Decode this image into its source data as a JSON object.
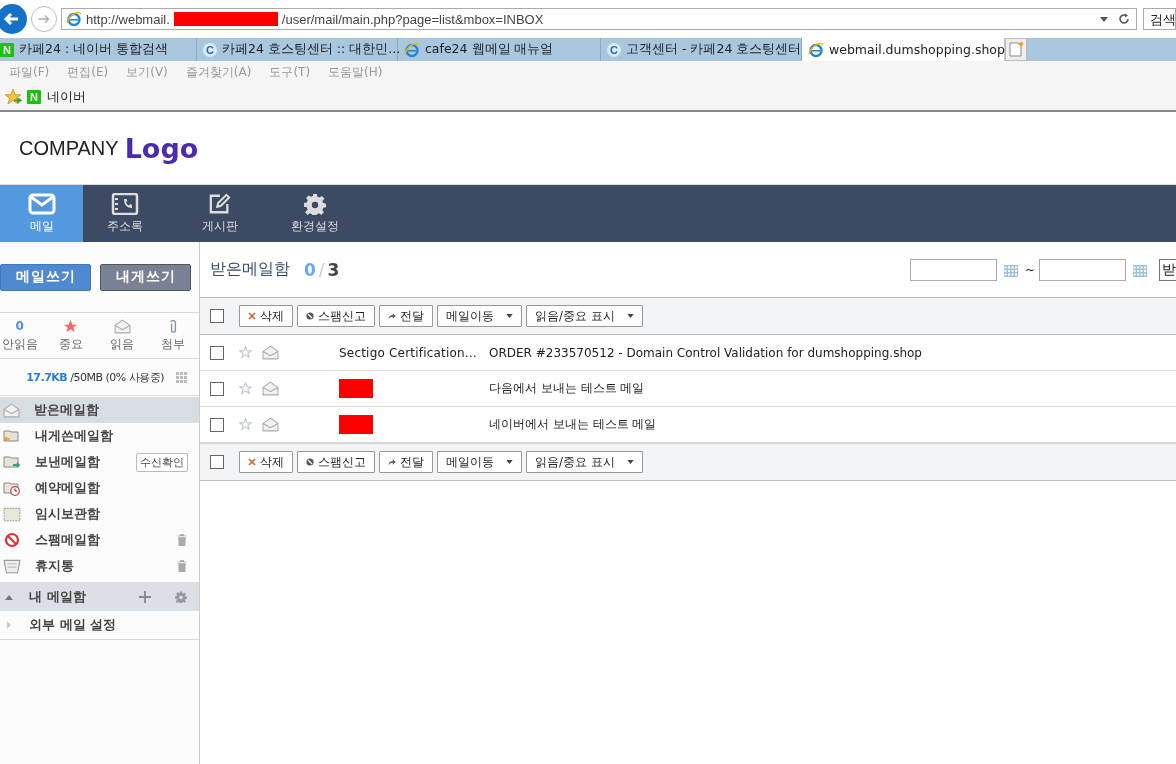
{
  "browser": {
    "url": {
      "prefix": "http://webmail.",
      "redacted": true,
      "suffix": "/user/mail/main.php?page=list&mbox=INBOX"
    },
    "search": "검색",
    "tabs": [
      {
        "label": "카페24 : 네이버 통합검색",
        "kind": "naver",
        "letter": "N",
        "selected": false
      },
      {
        "label": "카페24 호스팅센터 :: 대한민...",
        "kind": "cafe",
        "letter": "C",
        "selected": false
      },
      {
        "label": "cafe24 웹메일 매뉴얼",
        "kind": "ie",
        "selected": false
      },
      {
        "label": "고객센터 - 카페24 호스팅센터",
        "kind": "cafe",
        "letter": "C",
        "selected": false
      },
      {
        "label": "webmail.dumshopping.shop",
        "kind": "ie",
        "selected": true
      }
    ],
    "menu": [
      "파일(F)",
      "편집(E)",
      "보기(V)",
      "즐겨찾기(A)",
      "도구(T)",
      "도움말(H)"
    ],
    "favorites": [
      {
        "label": "네이버",
        "kind": "naver",
        "letter": "N"
      }
    ]
  },
  "logo": {
    "company": "COMPANY",
    "mark": "Logo"
  },
  "nav": [
    {
      "label": "메일",
      "kind": "mail",
      "selected": true
    },
    {
      "label": "주소록",
      "kind": "contacts",
      "selected": false
    },
    {
      "label": "게시판",
      "kind": "edit",
      "selected": false
    },
    {
      "label": "환경설정",
      "kind": "gear",
      "selected": false
    }
  ],
  "sidebar": {
    "buttons": [
      {
        "label": "메일쓰기",
        "kind": "primary"
      },
      {
        "label": "내게쓰기",
        "kind": "secondary"
      }
    ],
    "stats": [
      {
        "kind": "count",
        "value": "0",
        "label": "안읽음"
      },
      {
        "kind": "star",
        "label": "중요"
      },
      {
        "kind": "envelope",
        "label": "읽음"
      },
      {
        "kind": "clip",
        "label": "첨부"
      }
    ],
    "quota": {
      "used": "17.7KB",
      "total": "/50MB (0% 사용중)"
    },
    "folders": [
      {
        "label": "받은메일함",
        "kind": "inbox",
        "selected": true
      },
      {
        "label": "내게쓴메일함",
        "kind": "self",
        "selected": false
      },
      {
        "label": "보낸메일함",
        "kind": "sent",
        "selected": false,
        "action": "수신확인"
      },
      {
        "label": "예약메일함",
        "kind": "scheduled",
        "selected": false
      },
      {
        "label": "임시보관함",
        "kind": "draft",
        "selected": false
      },
      {
        "label": "스팸메일함",
        "kind": "spam",
        "selected": false,
        "emptiable": true
      },
      {
        "label": "휴지통",
        "kind": "trash",
        "selected": false,
        "emptiable": true
      }
    ],
    "my_folders": {
      "label": "내 메일함",
      "expanded": true
    },
    "external": {
      "label": "외부 메일 설정",
      "expanded": false
    }
  },
  "main": {
    "title": "받은메일함",
    "unread": "0",
    "separator": "/",
    "total": "3",
    "date_separator": "~",
    "select_cut": "받",
    "toolbar_top": {
      "checked": false,
      "buttons": [
        {
          "label": "삭제",
          "kind": "delete",
          "dropdown": false
        },
        {
          "label": "스팸신고",
          "kind": "spam",
          "dropdown": false
        },
        {
          "label": "전달",
          "kind": "forward",
          "dropdown": false
        },
        {
          "label": "메일이동",
          "kind": "menu",
          "dropdown": true
        },
        {
          "label": "읽음/중요 표시",
          "kind": "menu",
          "dropdown": true
        }
      ]
    },
    "rows": [
      {
        "checked": false,
        "starred": false,
        "sender": "Sectigo Certification…",
        "subject": "ORDER #233570512 - Domain Control Validation for dumshopping.shop"
      },
      {
        "checked": false,
        "starred": false,
        "redacted": true,
        "subject": "다음에서 보내는 테스트 메일"
      },
      {
        "checked": false,
        "starred": false,
        "redacted": true,
        "subject": "네이버에서 보내는 테스트 메일"
      }
    ],
    "toolbar_bottom": {
      "checked": false,
      "buttons": [
        {
          "label": "삭제",
          "kind": "delete",
          "dropdown": false
        },
        {
          "label": "스팸신고",
          "kind": "spam",
          "dropdown": false
        },
        {
          "label": "전달",
          "kind": "forward",
          "dropdown": false
        },
        {
          "label": "메일이동",
          "kind": "menu",
          "dropdown": true
        },
        {
          "label": "읽음/중요 표시",
          "kind": "menu",
          "dropdown": true
        }
      ]
    }
  }
}
